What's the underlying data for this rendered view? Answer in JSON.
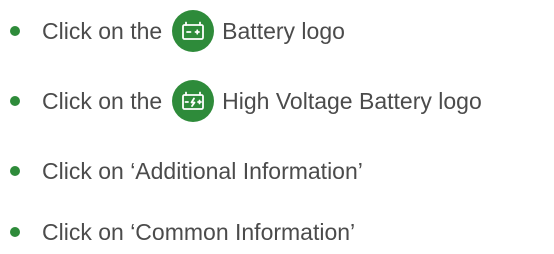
{
  "colors": {
    "accent_green": "#2e8b3a",
    "text": "#4b4b4b",
    "background": "#ffffff"
  },
  "steps": [
    {
      "prefix": "Click on the",
      "icon": "battery-icon",
      "suffix": "Battery logo"
    },
    {
      "prefix": "Click on the",
      "icon": "high-voltage-battery-icon",
      "suffix": "High Voltage Battery logo"
    },
    {
      "text": "Click on ‘Additional Information’"
    },
    {
      "text": "Click on ‘Common Information’"
    }
  ]
}
